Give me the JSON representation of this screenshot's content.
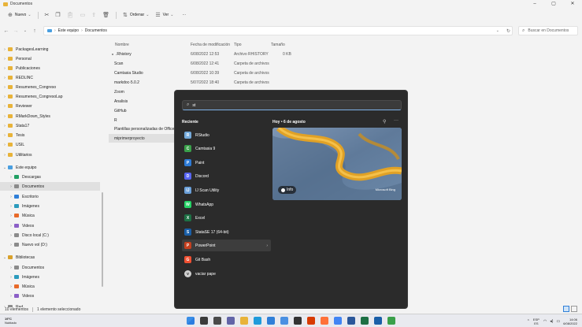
{
  "window": {
    "title": "Documentos"
  },
  "toolbar": {
    "new_label": "Nuevo",
    "sort_label": "Ordenar",
    "view_label": "Ver",
    "more_label": "···"
  },
  "address": {
    "crumbs": [
      "Este equipo",
      "Documentos"
    ],
    "search_placeholder": "Buscar en Documentos"
  },
  "nav": {
    "items": [
      {
        "label": "PackagesLearning",
        "icon": "folder"
      },
      {
        "label": "Personal",
        "icon": "folder"
      },
      {
        "label": "Publicaciones",
        "icon": "folder"
      },
      {
        "label": "REDLINC",
        "icon": "folder"
      },
      {
        "label": "Resumenes_Congreso",
        "icon": "folder"
      },
      {
        "label": "Resumenes_CongresoLap",
        "icon": "folder"
      },
      {
        "label": "Reviewer",
        "icon": "folder"
      },
      {
        "label": "RMarkDown_Styles",
        "icon": "folder"
      },
      {
        "label": "Stata17",
        "icon": "folder"
      },
      {
        "label": "Tesis",
        "icon": "folder"
      },
      {
        "label": "USIL",
        "icon": "folder"
      },
      {
        "label": "Utilitarios",
        "icon": "folder"
      },
      {
        "label": "Este equipo",
        "icon": "pc"
      },
      {
        "label": "Descargas",
        "icon": "green"
      },
      {
        "label": "Documentos",
        "icon": "drive"
      },
      {
        "label": "Escritorio",
        "icon": "blue"
      },
      {
        "label": "Imágenes",
        "icon": "teal"
      },
      {
        "label": "Música",
        "icon": "orange"
      },
      {
        "label": "Videos",
        "icon": "purple"
      },
      {
        "label": "Disco local (C:)",
        "icon": "drive"
      },
      {
        "label": "Nuevo vol (D:)",
        "icon": "drive"
      },
      {
        "label": "Bibliotecas",
        "icon": "lib"
      },
      {
        "label": "Documentos",
        "icon": "drive"
      },
      {
        "label": "Imágenes",
        "icon": "teal"
      },
      {
        "label": "Música",
        "icon": "orange"
      },
      {
        "label": "Videos",
        "icon": "purple"
      },
      {
        "label": "Red",
        "icon": "drive"
      }
    ]
  },
  "files": {
    "headers": {
      "name": "Nombre",
      "date": "Fecha de modificación",
      "type": "Tipo",
      "size": "Tamaño"
    },
    "rows": [
      {
        "name": ".Rhistory",
        "date": "6/08/2022 12:53",
        "type": "Archivo RHISTORY",
        "size": "0 KB",
        "icon": "doc"
      },
      {
        "name": "Scan",
        "date": "6/08/2022 12:41",
        "type": "Carpeta de archivos",
        "size": "",
        "icon": "folder"
      },
      {
        "name": "Camtasia Studio",
        "date": "6/08/2022 10:39",
        "type": "Carpeta de archivos",
        "size": "",
        "icon": "folder"
      },
      {
        "name": "markdoc-5.0.2",
        "date": "5/07/2022 18:40",
        "type": "Carpeta de archivos",
        "size": "",
        "icon": "folder"
      },
      {
        "name": "Zoom",
        "date": "",
        "type": "",
        "size": "",
        "icon": "folder"
      },
      {
        "name": "Analisis",
        "date": "",
        "type": "",
        "size": "",
        "icon": "folder"
      },
      {
        "name": "GitHub",
        "date": "",
        "type": "",
        "size": "",
        "icon": "folder"
      },
      {
        "name": "R",
        "date": "",
        "type": "",
        "size": "",
        "icon": "folder"
      },
      {
        "name": "Plantillas personalizadas de Office",
        "date": "",
        "type": "",
        "size": "",
        "icon": "folder"
      },
      {
        "name": "miprimerproyecto",
        "date": "",
        "type": "",
        "size": "",
        "icon": "folder"
      }
    ]
  },
  "status": {
    "count": "10 elementos",
    "selected": "1 elemento seleccionado"
  },
  "start": {
    "search_value": "st",
    "recent_heading": "Reciente",
    "apps": [
      {
        "label": "RStudio",
        "color": "#75aadb",
        "glyph": "R"
      },
      {
        "label": "Camtasia 9",
        "color": "#3aa04a",
        "glyph": "C"
      },
      {
        "label": "Paint",
        "color": "#2e7bd6",
        "glyph": "P"
      },
      {
        "label": "Discord",
        "color": "#5865f2",
        "glyph": "D"
      },
      {
        "label": "IJ Scan Utility",
        "color": "#6a9fd8",
        "glyph": "IJ"
      },
      {
        "label": "WhatsApp",
        "color": "#25d366",
        "glyph": "W"
      },
      {
        "label": "Excel",
        "color": "#1d7044",
        "glyph": "X"
      },
      {
        "label": "StataSE 17 (64-bit)",
        "color": "#1a5fa8",
        "glyph": "S"
      },
      {
        "label": "PowerPoint",
        "color": "#c4401f",
        "glyph": "P"
      },
      {
        "label": "Git Bash",
        "color": "#f05032",
        "glyph": "G"
      },
      {
        "label": "vaciar pape",
        "color": "#d0d0d0",
        "glyph": "v"
      }
    ],
    "today_heading": "Hoy • 6 de agosto",
    "info_label": "Info",
    "card_brand": "Microsoft Bing"
  },
  "taskbar": {
    "weather_temp": "19°C",
    "weather_desc": "Nublado",
    "lang_top": "ESP",
    "lang_bottom": "ES",
    "time": "14:06",
    "date": "6/08/2022"
  }
}
